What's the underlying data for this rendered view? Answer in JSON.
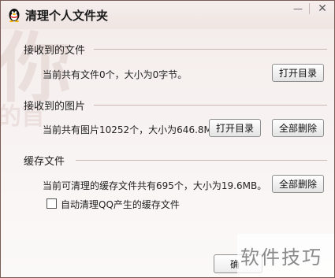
{
  "window": {
    "title": "清理个人文件夹",
    "min_icon": "minimize-icon",
    "close_icon": "close-icon",
    "app_icon": "qq-penguin-icon"
  },
  "background": {
    "glyph": "你",
    "glyph2": "的首"
  },
  "received_files": {
    "title": "接收到的文件",
    "info": "当前共有文件0个，大小为0字节。",
    "open_button": "打开目录"
  },
  "received_images": {
    "title": "接收到的图片",
    "info": "当前共有图片10252个，大小为646.8MB。",
    "open_button": "打开目录",
    "delete_all_button": "全部删除"
  },
  "cache_files": {
    "title": "缓存文件",
    "info": "当前可清理的缓存文件共有695个，大小为19.6MB。",
    "delete_all_button": "全部删除",
    "auto_clean_label": "自动清理QQ产生的缓存文件",
    "auto_clean_checked": false
  },
  "footer": {
    "button_label": "确"
  },
  "watermark": {
    "text": "软件技巧"
  }
}
